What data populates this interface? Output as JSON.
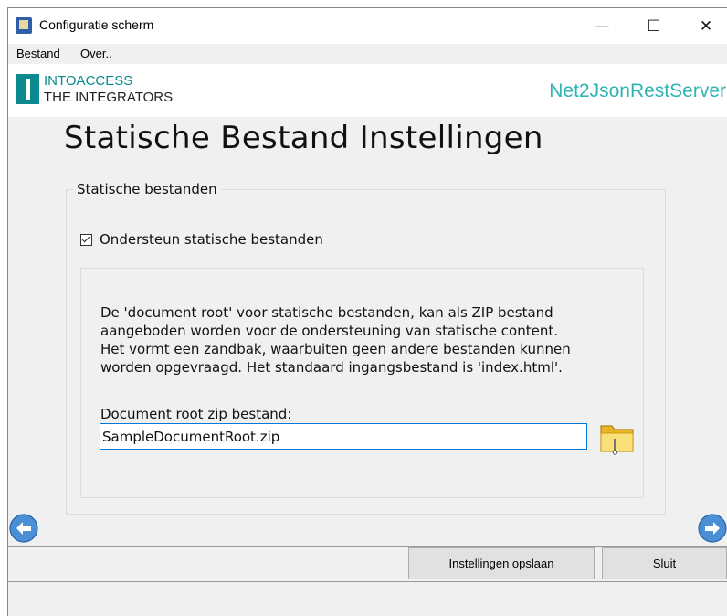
{
  "window": {
    "title": "Configuratie scherm",
    "controls": {
      "minimize": "—",
      "maximize": "☐",
      "close": "✕"
    }
  },
  "menu": {
    "items": [
      "Bestand",
      "Over.."
    ]
  },
  "brand": {
    "logo_top": "INTOACCESS",
    "logo_bottom": "THE INTEGRATORS",
    "app_name": "Net2JsonRestServer",
    "colors": {
      "logo": "#0a8a8f",
      "app_name": "#2fb3b3"
    }
  },
  "page": {
    "heading": "Statische Bestand Instellingen",
    "group_title": "Statische bestanden",
    "checkbox_label": "Ondersteun statische bestanden",
    "checkbox_checked": true,
    "description_lines": [
      "De 'document root' voor statische bestanden, kan als ZIP bestand",
      "aangeboden worden voor de ondersteuning van statische content.",
      "Het vormt een zandbak, waarbuiten geen andere bestanden kunnen",
      "worden opgevraagd. Het standaard ingangsbestand is 'index.html'."
    ],
    "field_label": "Document root zip bestand:",
    "field_value": "SampleDocumentRoot.zip",
    "browse_icon": "folder-icon"
  },
  "nav": {
    "back_icon": "arrow-left-circle-icon",
    "forward_icon": "arrow-right-circle-icon"
  },
  "buttons": {
    "save": "Instellingen opslaan",
    "close": "Sluit"
  }
}
